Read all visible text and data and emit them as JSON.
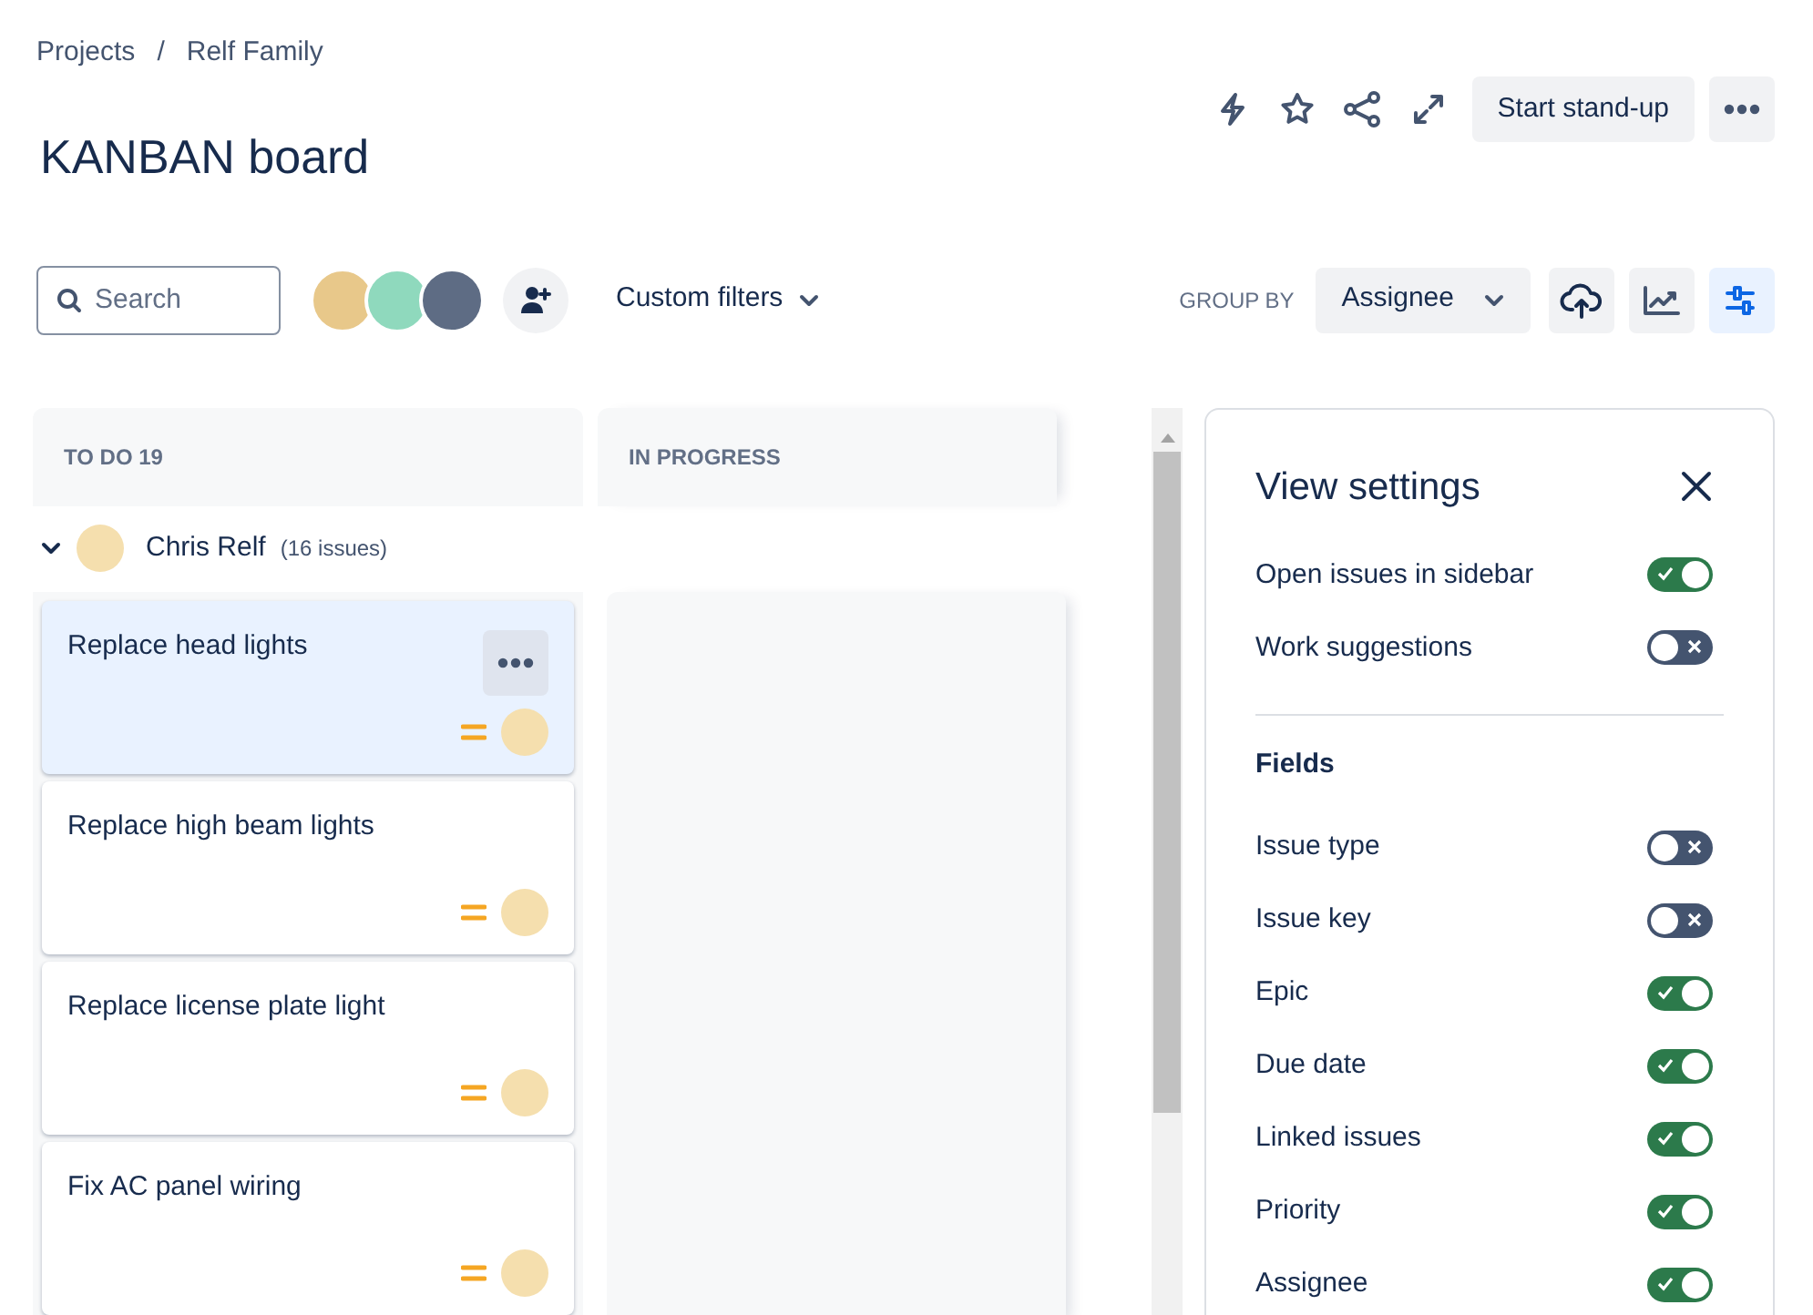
{
  "breadcrumbs": [
    "Projects",
    "Relf Family"
  ],
  "breadcrumb_separator": "/",
  "title": "KANBAN board",
  "header_button": "Start stand-up",
  "toolbar": {
    "search": {
      "placeholder": "Search"
    },
    "filters": "Custom filters",
    "group_by_label": "GROUP BY",
    "group_by": "Assignee",
    "view_settings_selected": true
  },
  "columns": [
    {
      "title": "TO DO 19"
    },
    {
      "title": "IN PROGRESS"
    }
  ],
  "swimlane": {
    "name": "Chris Relf",
    "count": "(16 issues)",
    "expanded": true
  },
  "cards": [
    {
      "title": "Replace head lights",
      "selected": true
    },
    {
      "title": "Replace high beam lights",
      "selected": false
    },
    {
      "title": "Replace license plate light",
      "selected": false
    },
    {
      "title": "Fix AC panel wiring",
      "selected": false
    }
  ],
  "view_settings": {
    "title": "View settings",
    "options": [
      {
        "label": "Open issues in sidebar",
        "on": true
      },
      {
        "label": "Work suggestions",
        "on": false
      }
    ],
    "fields_heading": "Fields",
    "fields": [
      {
        "label": "Issue type",
        "on": false
      },
      {
        "label": "Issue key",
        "on": false
      },
      {
        "label": "Epic",
        "on": true
      },
      {
        "label": "Due date",
        "on": true
      },
      {
        "label": "Linked issues",
        "on": true
      },
      {
        "label": "Priority",
        "on": true
      },
      {
        "label": "Assignee",
        "on": true
      }
    ]
  }
}
